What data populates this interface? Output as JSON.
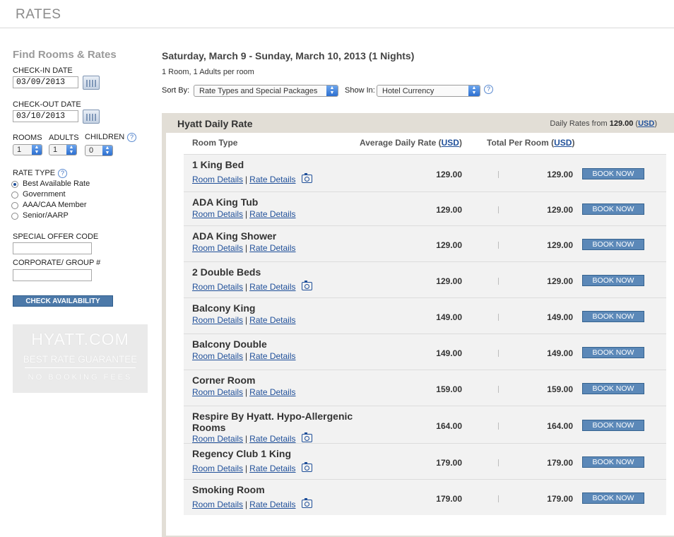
{
  "header": {
    "title": "RATES"
  },
  "sidebar": {
    "title": "Find Rooms & Rates",
    "checkin_label": "CHECK-IN DATE",
    "checkin_value": "03/09/2013",
    "checkout_label": "CHECK-OUT DATE",
    "checkout_value": "03/10/2013",
    "rooms_label": "ROOMS",
    "rooms_value": "1",
    "adults_label": "ADULTS",
    "adults_value": "1",
    "children_label": "CHILDREN",
    "children_value": "0",
    "rate_type_label": "RATE TYPE",
    "rate_types": [
      "Best Available Rate",
      "Government",
      "AAA/CAA Member",
      "Senior/AARP"
    ],
    "rate_type_selected": "Best Available Rate",
    "offer_code_label": "SPECIAL OFFER CODE",
    "corporate_label": "CORPORATE/ GROUP #",
    "check_button": "CHECK AVAILABILITY",
    "promo": {
      "line1": "HYATT.COM",
      "line2": "BEST RATE GUARANTEE",
      "line3": "NO BOOKING FEES"
    }
  },
  "main": {
    "title": "Saturday, March 9 - Sunday, March 10, 2013 (1 Nights)",
    "subtitle": "1 Room, 1 Adults per room",
    "sort_label": "Sort By:",
    "sort_value": "Rate Types and Special Packages",
    "show_label": "Show In:",
    "show_value": "Hotel Currency",
    "panel": {
      "name": "Hyatt Daily Rate",
      "from_prefix": "Daily Rates from",
      "from_value": "129.00",
      "from_currency": "USD",
      "col_room": "Room Type",
      "col_avg": "Average Daily Rate (",
      "col_total": "Total Per Room (",
      "currency": "USD",
      "col_close": ")",
      "room_details": "Room Details",
      "rate_details": "Rate Details",
      "separator": "|",
      "book_label": "BOOK NOW",
      "rooms": [
        {
          "name": "1 King Bed",
          "avg": "129.00",
          "total": "129.00",
          "photo": true
        },
        {
          "name": "ADA King Tub",
          "avg": "129.00",
          "total": "129.00",
          "photo": false
        },
        {
          "name": "ADA King Shower",
          "avg": "129.00",
          "total": "129.00",
          "photo": false
        },
        {
          "name": "2 Double Beds",
          "avg": "129.00",
          "total": "129.00",
          "photo": true
        },
        {
          "name": "Balcony King",
          "avg": "149.00",
          "total": "149.00",
          "photo": false
        },
        {
          "name": "Balcony Double",
          "avg": "149.00",
          "total": "149.00",
          "photo": false
        },
        {
          "name": "Corner Room",
          "avg": "159.00",
          "total": "159.00",
          "photo": false
        },
        {
          "name": "Respire By Hyatt. Hypo-Allergenic Rooms",
          "avg": "164.00",
          "total": "164.00",
          "photo": true
        },
        {
          "name": "Regency Club 1 King",
          "avg": "179.00",
          "total": "179.00",
          "photo": true
        },
        {
          "name": "Smoking Room",
          "avg": "179.00",
          "total": "179.00",
          "photo": true
        }
      ]
    }
  }
}
